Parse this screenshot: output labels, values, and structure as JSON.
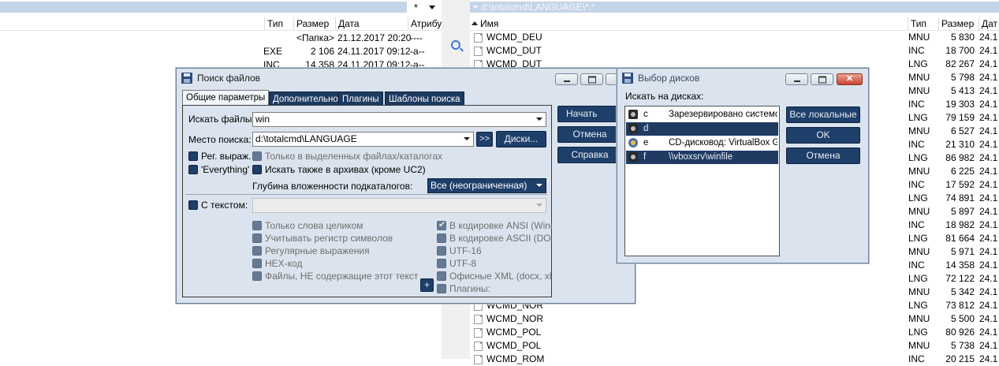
{
  "left_panel": {
    "header": {
      "sort_mark": "*",
      "columns": [
        "Тип",
        "Размер",
        "Дата",
        "Атрибу"
      ]
    },
    "rows": [
      {
        "type": "",
        "size": "<Папка>",
        "date": "21.12.2017 20:20",
        "attr": "----"
      },
      {
        "type": "EXE",
        "size": "2 106",
        "date": "24.11.2017 09:12",
        "attr": "-a--"
      },
      {
        "type": "INC",
        "size": "14 358",
        "date": "24.11.2017 09:12",
        "attr": "-a--"
      }
    ]
  },
  "right_panel": {
    "path": "d:\\totalcmd\\LANGUAGE\\*.*",
    "header": {
      "name": "Имя",
      "type": "Тип",
      "size": "Размер",
      "date": "Дат"
    },
    "rows": [
      {
        "name": "WCMD_DEU",
        "type": "MNU",
        "size": "5 830",
        "date": "24.1"
      },
      {
        "name": "WCMD_DUT",
        "type": "INC",
        "size": "18 700",
        "date": "24.1"
      },
      {
        "name": "WCMD_DUT",
        "type": "LNG",
        "size": "82 267",
        "date": "24.1"
      },
      {
        "name": "",
        "type": "MNU",
        "size": "5 798",
        "date": "24.1"
      },
      {
        "name": "",
        "type": "MNU",
        "size": "5 413",
        "date": "24.1"
      },
      {
        "name": "",
        "type": "INC",
        "size": "19 303",
        "date": "24.1"
      },
      {
        "name": "",
        "type": "LNG",
        "size": "79 159",
        "date": "24.1"
      },
      {
        "name": "",
        "type": "MNU",
        "size": "6 527",
        "date": "24.1"
      },
      {
        "name": "",
        "type": "INC",
        "size": "21 310",
        "date": "24.1"
      },
      {
        "name": "",
        "type": "LNG",
        "size": "86 982",
        "date": "24.1"
      },
      {
        "name": "",
        "type": "MNU",
        "size": "6 225",
        "date": "24.1"
      },
      {
        "name": "",
        "type": "INC",
        "size": "17 592",
        "date": "24.1"
      },
      {
        "name": "",
        "type": "LNG",
        "size": "74 891",
        "date": "24.1"
      },
      {
        "name": "",
        "type": "MNU",
        "size": "5 897",
        "date": "24.1"
      },
      {
        "name": "",
        "type": "INC",
        "size": "18 982",
        "date": "24.1"
      },
      {
        "name": "",
        "type": "LNG",
        "size": "81 664",
        "date": "24.1"
      },
      {
        "name": "",
        "type": "MNU",
        "size": "5 971",
        "date": "24.1"
      },
      {
        "name": "",
        "type": "INC",
        "size": "14 358",
        "date": "24.1"
      },
      {
        "name": "",
        "type": "LNG",
        "size": "72 122",
        "date": "24.1"
      },
      {
        "name": "",
        "type": "MNU",
        "size": "5 342",
        "date": "24.1"
      },
      {
        "name": "WCMD_NOR",
        "type": "LNG",
        "size": "73 812",
        "date": "24.1"
      },
      {
        "name": "WCMD_NOR",
        "type": "MNU",
        "size": "5 500",
        "date": "24.1"
      },
      {
        "name": "WCMD_POL",
        "type": "LNG",
        "size": "80 926",
        "date": "24.1"
      },
      {
        "name": "WCMD_POL",
        "type": "MNU",
        "size": "5 738",
        "date": "24.1"
      },
      {
        "name": "WCMD_ROM",
        "type": "INC",
        "size": "20 215",
        "date": "24.1"
      }
    ]
  },
  "search_dialog": {
    "title": "Поиск файлов",
    "tabs": [
      "Общие параметры",
      "Дополнительно",
      "Плагины",
      "Шаблоны поиска"
    ],
    "search_for_label": "Искать файлы:",
    "search_for_value": "win",
    "search_in_label": "Место поиска:",
    "search_in_value": "d:\\totalcmd\\LANGUAGE",
    "arrows_button": ">>",
    "drives_button": "Диски...",
    "regex_label": "Рег. выраж.",
    "everything_label": "'Everything'",
    "only_selected_label": "Только в выделенных файлах/каталогах",
    "archives_label": "Искать также в архивах (кроме UC2)",
    "depth_label": "Глубина вложенности подкаталогов:",
    "depth_value": "Все (неограниченная)",
    "with_text_label": "С текстом:",
    "text_value": "",
    "options_left": [
      "Только слова целиком",
      "Учитывать регистр символов",
      "Регулярные выражения",
      "HEX-код",
      "Файлы, НЕ содержащие этот текст"
    ],
    "options_right": [
      "В кодировке ANSI (Windo",
      "В кодировке ASCII (DOS)",
      "UTF-16",
      "UTF-8",
      "Офисные XML (docx, xlsx,",
      "Плагины:"
    ],
    "plus_button": "+",
    "start_button": "Начать поиск",
    "cancel_button": "Отмена",
    "help_button": "Справка"
  },
  "drives_dialog": {
    "title": "Выбор дисков",
    "search_label": "Искать на дисках:",
    "drives": [
      {
        "letter": "c",
        "label": "Зарезервировано системой"
      },
      {
        "letter": "d",
        "label": ""
      },
      {
        "letter": "e",
        "label": "CD-дисковод: VirtualBox Guest"
      },
      {
        "letter": "f",
        "label": "\\\\vboxsrv\\winfile"
      }
    ],
    "all_local_button": "Все локальные",
    "ok_button": "OK",
    "cancel_button": "Отмена"
  },
  "colors": {
    "accent": "#1e3f69",
    "dialog_bg": "#dbe4ee",
    "selection": "#1f3b62"
  }
}
